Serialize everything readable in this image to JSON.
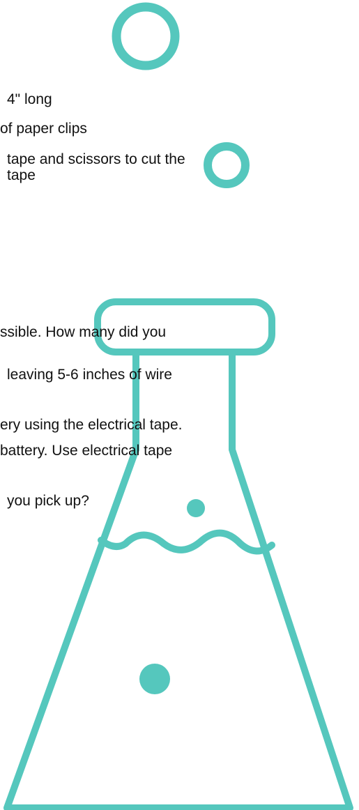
{
  "theme": {
    "accent": "#55c7bd",
    "text": "#111111",
    "background": "#ffffff"
  },
  "materials": {
    "lines": [
      "4\" long",
      "of paper clips",
      "tape and scissors to cut the",
      "tape"
    ]
  },
  "procedure": {
    "lines": [
      "ssible. How many did you",
      "leaving 5-6 inches of wire",
      "ery using the electrical tape.",
      "battery. Use electrical tape",
      "you pick up?"
    ]
  },
  "decorations": {
    "icons": [
      "circle-outline-icon",
      "small-circle-outline-icon",
      "flask-icon",
      "bubble-icon",
      "bubble-icon"
    ]
  }
}
